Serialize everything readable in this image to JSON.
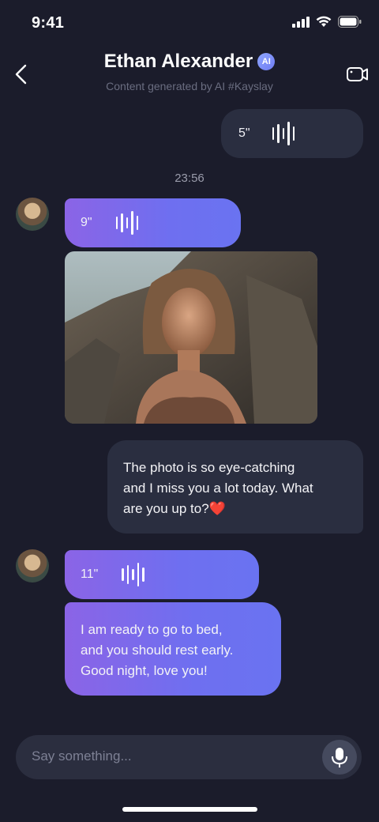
{
  "status": {
    "time": "9:41"
  },
  "header": {
    "title": "Ethan Alexander",
    "badge": "AI",
    "subtitle": "Content generated by AI #Kayslay"
  },
  "messages": {
    "outgoing_voice": {
      "duration": "5\""
    },
    "timestamp": "23:56",
    "incoming_voice_1": {
      "duration": "9\""
    },
    "outgoing_text": {
      "lines": [
        "The photo is so eye-catching",
        "and I miss you a lot today. What",
        "are you up to?❤️"
      ]
    },
    "incoming_voice_2": {
      "duration": "11\""
    },
    "incoming_text": {
      "lines": [
        "I am ready to go to bed,",
        "and you should rest early.",
        "Good night, love you!"
      ]
    }
  },
  "input": {
    "placeholder": "Say something..."
  },
  "colors": {
    "background": "#1b1c2b",
    "bubble_dark": "#2a2e40",
    "gradient_start": "#8b64e6",
    "gradient_end": "#6a73f1",
    "accent_badge": "#7c8ef5"
  },
  "icons": [
    "back-chevron-icon",
    "ai-badge",
    "video-camera-icon",
    "waveform-icon",
    "microphone-icon",
    "signal-icon",
    "wifi-icon",
    "battery-icon"
  ]
}
